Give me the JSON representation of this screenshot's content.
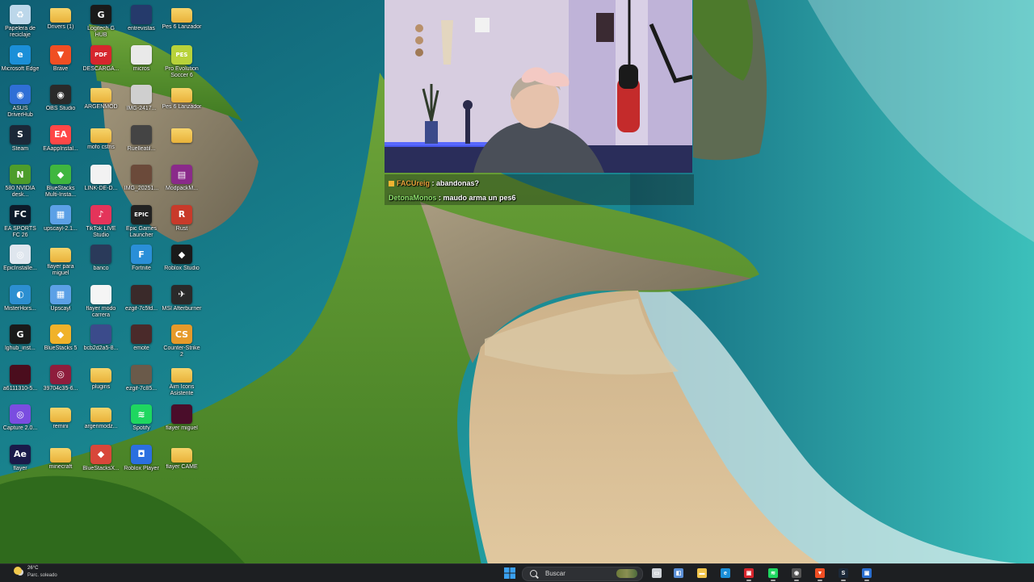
{
  "desktop": {
    "icons": [
      [
        {
          "label": "Papelera de reciclaje",
          "icon": "recycle-bin-icon",
          "color": "#bcd7ea",
          "glyph": "♻"
        },
        {
          "label": "Microsoft Edge",
          "icon": "edge-icon",
          "color": "#1b8fd8",
          "glyph": "e"
        },
        {
          "label": "ASUS DriverHub",
          "icon": "asus-driverhub-icon",
          "color": "#2f6fd6",
          "glyph": "◉"
        },
        {
          "label": "Steam",
          "icon": "steam-icon",
          "color": "#1b2838",
          "glyph": "S"
        },
        {
          "label": "580 NVIDIA desk...",
          "icon": "nvidia-icon",
          "color": "#4d9d2b",
          "glyph": "N"
        },
        {
          "label": "EA SPORTS FC 26",
          "icon": "ea-fc-icon",
          "color": "#0d1b2a",
          "glyph": "FC"
        },
        {
          "label": "EpicInstalle...",
          "icon": "installer-icon",
          "color": "#dfe6ee",
          "glyph": "◎"
        },
        {
          "label": "MisterHors...",
          "icon": "misterhorse-icon",
          "color": "#2c8fd1",
          "glyph": "◐"
        },
        {
          "label": "lghub_inst...",
          "icon": "logitech-icon",
          "color": "#1a1a1a",
          "glyph": "G"
        },
        {
          "label": "a6111310-5...",
          "icon": "image-icon",
          "color": "#4a0d1d",
          "glyph": ""
        },
        {
          "label": "Capture 2.0...",
          "icon": "capture-icon",
          "color": "#7a4de0",
          "glyph": "◎"
        },
        {
          "label": "flayer",
          "icon": "after-effects-icon",
          "color": "#1a1a4a",
          "glyph": "Ae"
        }
      ],
      [
        {
          "label": "Drivers (1)",
          "icon": "folder-icon",
          "color": "#e9b23a",
          "glyph": "",
          "folder": true
        },
        {
          "label": "Brave",
          "icon": "brave-icon",
          "color": "#f04e23",
          "glyph": "▼"
        },
        {
          "label": "OBS Studio",
          "icon": "obs-icon",
          "color": "#2a2a2a",
          "glyph": "◉"
        },
        {
          "label": "EAappInstal...",
          "icon": "ea-app-icon",
          "color": "#ff4747",
          "glyph": "EA"
        },
        {
          "label": "BlueStacks Multi-Insta...",
          "icon": "bluestacks-icon",
          "color": "#3fb63f",
          "glyph": "◆"
        },
        {
          "label": "upscayl-2.1...",
          "icon": "upscayl-icon",
          "color": "#5ba0e6",
          "glyph": "▦"
        },
        {
          "label": "flayer para miguel",
          "icon": "folder-icon",
          "color": "#e9b23a",
          "glyph": "",
          "folder": true
        },
        {
          "label": "Upscayl",
          "icon": "upscayl-icon",
          "color": "#5ba0e6",
          "glyph": "▦"
        },
        {
          "label": "BlueStacks 5",
          "icon": "bluestacks-icon",
          "color": "#f0b22a",
          "glyph": "◆"
        },
        {
          "label": "39704c35-6...",
          "icon": "image-icon",
          "color": "#8e1d3c",
          "glyph": "◎"
        },
        {
          "label": "remini",
          "icon": "folder-icon",
          "color": "#e9b23a",
          "glyph": "",
          "folder": true
        },
        {
          "label": "minecraft",
          "icon": "folder-icon",
          "color": "#e9b23a",
          "glyph": "",
          "folder": true
        }
      ],
      [
        {
          "label": "Logitech G HUB",
          "icon": "logitech-icon",
          "color": "#1a1a1a",
          "glyph": "G"
        },
        {
          "label": "DESCARGA...",
          "icon": "pdf-icon",
          "color": "#d6262d",
          "glyph": "PDF"
        },
        {
          "label": "ARGENMOD",
          "icon": "folder-icon",
          "color": "#e9b23a",
          "glyph": "",
          "folder": true
        },
        {
          "label": "mofo cstris",
          "icon": "folder-icon",
          "color": "#b7d34a",
          "glyph": "",
          "folder": true
        },
        {
          "label": "LINK-DE-D...",
          "icon": "document-icon",
          "color": "#f2f2f2",
          "glyph": ""
        },
        {
          "label": "TikTok LIVE Studio",
          "icon": "tiktok-icon",
          "color": "#e4345a",
          "glyph": "♪"
        },
        {
          "label": "banco",
          "icon": "image-icon",
          "color": "#2a3a5a",
          "glyph": ""
        },
        {
          "label": "flayer modo carrera",
          "icon": "document-icon",
          "color": "#f5f5f5",
          "glyph": ""
        },
        {
          "label": "bcb2d2a5-8...",
          "icon": "image-icon",
          "color": "#3b4b8b",
          "glyph": ""
        },
        {
          "label": "plugins",
          "icon": "folder-icon",
          "color": "#e9b23a",
          "glyph": "",
          "folder": true
        },
        {
          "label": "argenmodz...",
          "icon": "folder-icon",
          "color": "#e9b23a",
          "glyph": "",
          "folder": true
        },
        {
          "label": "BlueStacksX...",
          "icon": "bluestacks-icon",
          "color": "#d8473a",
          "glyph": "◆"
        }
      ],
      [
        {
          "label": "entrevistas",
          "icon": "image-icon",
          "color": "#253a6b",
          "glyph": ""
        },
        {
          "label": "micros",
          "icon": "image-icon",
          "color": "#e9e9e9",
          "glyph": ""
        },
        {
          "label": "IMG-2417...",
          "icon": "image-icon",
          "color": "#cfcfcf",
          "glyph": ""
        },
        {
          "label": "Ruelleatil...",
          "icon": "image-icon",
          "color": "#444",
          "glyph": ""
        },
        {
          "label": "IMG_20251...",
          "icon": "image-icon",
          "color": "#6b4a3a",
          "glyph": ""
        },
        {
          "label": "Epic Games Launcher",
          "icon": "epic-games-icon",
          "color": "#222",
          "glyph": "EPIC"
        },
        {
          "label": "Fortnite",
          "icon": "fortnite-icon",
          "color": "#2a8fd8",
          "glyph": "F"
        },
        {
          "label": "ezgif-7c5fd...",
          "icon": "image-icon",
          "color": "#3a2a2a",
          "glyph": ""
        },
        {
          "label": "emote",
          "icon": "image-icon",
          "color": "#4a2a2a",
          "glyph": ""
        },
        {
          "label": "ezgif-7c85...",
          "icon": "image-icon",
          "color": "#6a5a4a",
          "glyph": ""
        },
        {
          "label": "Spotify",
          "icon": "spotify-icon",
          "color": "#1ed760",
          "glyph": "≋"
        },
        {
          "label": "Roblox Player",
          "icon": "roblox-icon",
          "color": "#2b6fe0",
          "glyph": "◘"
        }
      ],
      [
        {
          "label": "Pes 6 Lanzador",
          "icon": "folder-icon",
          "color": "#e9b23a",
          "glyph": "",
          "folder": true
        },
        {
          "label": "Pro Evolution Soccer 6",
          "icon": "pes6-icon",
          "color": "#b8d23a",
          "glyph": "PES"
        },
        {
          "label": "Pes 6 Lanzador",
          "icon": "folder-icon",
          "color": "#e9b23a",
          "glyph": "",
          "folder": true
        },
        {
          "label": "",
          "icon": "folder-icon",
          "color": "#e9b23a",
          "glyph": "",
          "folder": true
        },
        {
          "label": "ModpackM...",
          "icon": "winrar-icon",
          "color": "#8a2a8a",
          "glyph": "▤"
        },
        {
          "label": "Rust",
          "icon": "rust-icon",
          "color": "#c83a2a",
          "glyph": "R"
        },
        {
          "label": "Roblox Studio",
          "icon": "roblox-studio-icon",
          "color": "#1a1a1a",
          "glyph": "◆"
        },
        {
          "label": "MSI Afterburner",
          "icon": "msi-icon",
          "color": "#2a2a2a",
          "glyph": "✈"
        },
        {
          "label": "Counter-Strike 2",
          "icon": "cs2-icon",
          "color": "#e69a2a",
          "glyph": "CS"
        },
        {
          "label": "Aim Icons Asistente",
          "icon": "folder-icon",
          "color": "#e9b23a",
          "glyph": "",
          "folder": true
        },
        {
          "label": "flayer miguel",
          "icon": "image-icon",
          "color": "#4a0d2a",
          "glyph": ""
        },
        {
          "label": "flayer CAME",
          "icon": "folder-icon",
          "color": "#e9b23a",
          "glyph": "",
          "folder": true
        }
      ]
    ]
  },
  "chat": {
    "messages": [
      {
        "user": "FACUreig",
        "text": " : abandonas?"
      },
      {
        "user": "DetonaMonos",
        "text": " : maudo arma un pes6"
      }
    ]
  },
  "taskbar": {
    "weather_temp": "26°C",
    "weather_condition": "Parc. soleado",
    "search_placeholder": "Buscar",
    "apps": [
      {
        "icon": "task-view-icon",
        "color": "#cfd3d8",
        "glyph": "▭"
      },
      {
        "icon": "widgets-icon",
        "color": "#5b8fd6",
        "glyph": "◧"
      },
      {
        "icon": "file-explorer-icon",
        "color": "#f1c44a",
        "glyph": "▬"
      },
      {
        "icon": "edge-icon",
        "color": "#1b8fd8",
        "glyph": "e"
      },
      {
        "icon": "app-icon",
        "color": "#d8262d",
        "glyph": "▣"
      },
      {
        "icon": "spotify-icon",
        "color": "#1ed760",
        "glyph": "≋"
      },
      {
        "icon": "obs-icon",
        "color": "#555",
        "glyph": "◉"
      },
      {
        "icon": "brave-icon",
        "color": "#f04e23",
        "glyph": "▼"
      },
      {
        "icon": "steam-icon",
        "color": "#1b2838",
        "glyph": "S"
      },
      {
        "icon": "app-icon",
        "color": "#2a6fd0",
        "glyph": "▣"
      }
    ]
  }
}
